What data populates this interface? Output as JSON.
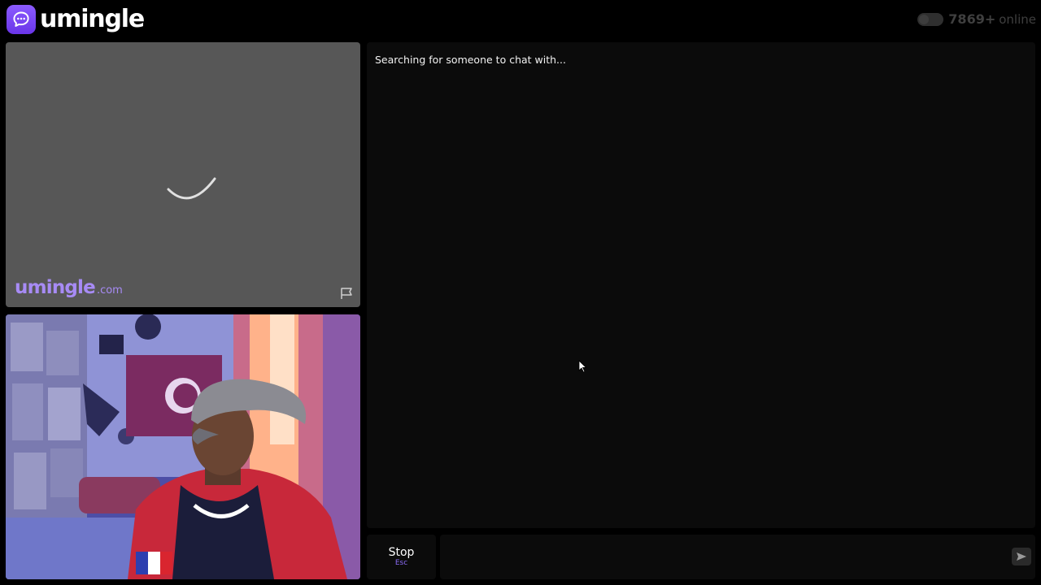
{
  "header": {
    "logo_text": "umingle",
    "online_count": "7869+",
    "online_label": "online"
  },
  "stranger_video": {
    "watermark_main": "umingle",
    "watermark_domain": ".com"
  },
  "chat": {
    "status": "Searching for someone to chat with..."
  },
  "controls": {
    "stop_label": "Stop",
    "stop_hint": "Esc",
    "message_value": ""
  },
  "colors": {
    "brand": "#7c4dff",
    "watermark": "#a78bf5",
    "panel": "#0b0b0b",
    "video_bg": "#575757"
  },
  "icons": {
    "logo": "chat-bubble-icon",
    "report": "flag-icon",
    "send": "send-icon",
    "loading": "spinner-icon",
    "cursor": "mouse-cursor-icon"
  }
}
